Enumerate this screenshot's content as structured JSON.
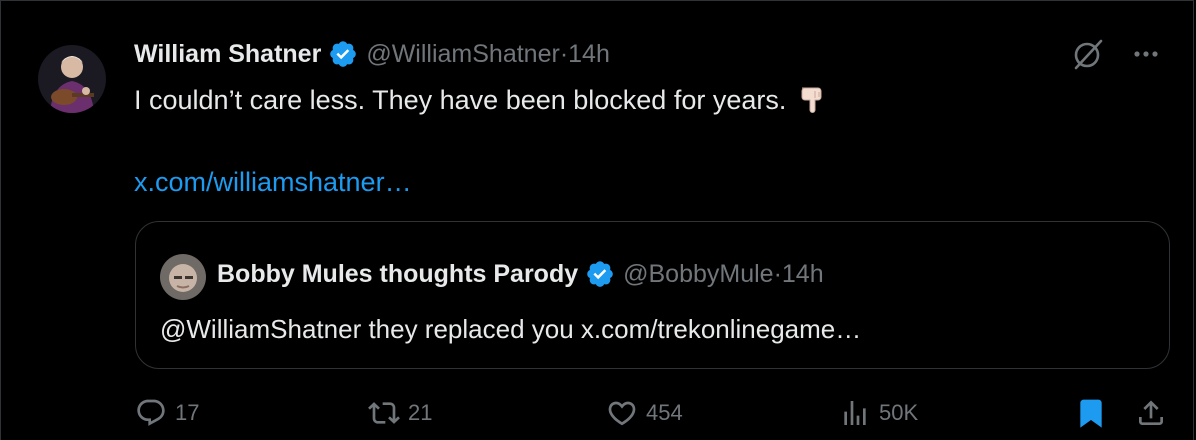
{
  "tweet": {
    "author_name": "William Shatner",
    "handle": "@WilliamShatner",
    "separator": "·",
    "time": "14h",
    "text": "I couldn’t care less. They have been blocked for years.",
    "emoji_icon": "backhand-index-pointing-down-icon",
    "link": "x.com/williamshatner…"
  },
  "quoted_tweet": {
    "author_name": "Bobby Mules thoughts Parody",
    "handle": "@BobbyMule",
    "separator": "·",
    "time": "14h",
    "text": "@WilliamShatner they replaced you x.com/trekonlinegame…"
  },
  "actions": {
    "replies": "17",
    "reposts": "21",
    "likes": "454",
    "views": "50K"
  },
  "colors": {
    "background": "#000000",
    "text": "#e7e9ea",
    "muted": "#71767b",
    "accent": "#1d9bf0",
    "border": "#2f3336",
    "bookmark_active": "#1d9bf0"
  }
}
